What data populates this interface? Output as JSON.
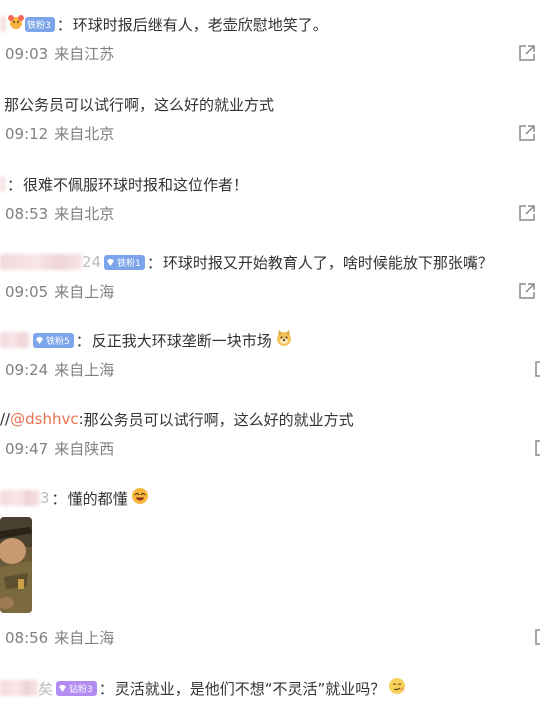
{
  "comments": [
    {
      "badge": "铁粉3",
      "separator": "：",
      "text": "环球时报后继有人，老壶欣慰地笑了。",
      "time": "09:03",
      "location": "来自江苏"
    },
    {
      "text": "那公务员可以试行啊，这么好的就业方式",
      "time": "09:12",
      "location": "来自北京"
    },
    {
      "separator": "：",
      "text": "很难不佩服环球时报和这位作者！",
      "time": "08:53",
      "location": "来自北京"
    },
    {
      "name_partial": "24",
      "badge": "铁粉1",
      "separator": "：",
      "text": "环球时报又开始教育人了，啥时候能放下那张嘴？",
      "time": "09:05",
      "location": "来自上海"
    },
    {
      "badge": "铁粉5",
      "separator": "：",
      "text": "反正我大环球垄断一块市场",
      "emoji": "doge",
      "time": "09:24",
      "location": "来自上海"
    },
    {
      "repost_prefix": "//",
      "mention": "@dshhvc",
      "separator": ":",
      "text": "那公务员可以试行啊，这么好的就业方式",
      "time": "09:47",
      "location": "来自陕西"
    },
    {
      "name_partial": "3",
      "separator": "：",
      "text": "懂的都懂",
      "emoji": "laughing",
      "has_photo": true,
      "time": "08:56",
      "location": "来自上海"
    },
    {
      "name_partial": "矣",
      "badge": "钻粉3",
      "separator": "：",
      "text": "灵活就业，是他们不想“不灵活”就业吗？",
      "emoji": "smirk"
    }
  ],
  "icons": {
    "share": "share-external-icon",
    "badge_gem": "diamond-icon",
    "emoji_1": "doge-emoji-icon",
    "emoji_2": "laughing-emoji-icon",
    "emoji_3": "smirk-emoji-icon"
  },
  "colors": {
    "text": "#333333",
    "meta": "#808080",
    "mention": "#eb7350",
    "badge_blue": "#7ba4ea",
    "badge_purple": "#b28cf0",
    "icon": "#8a8a8a"
  }
}
